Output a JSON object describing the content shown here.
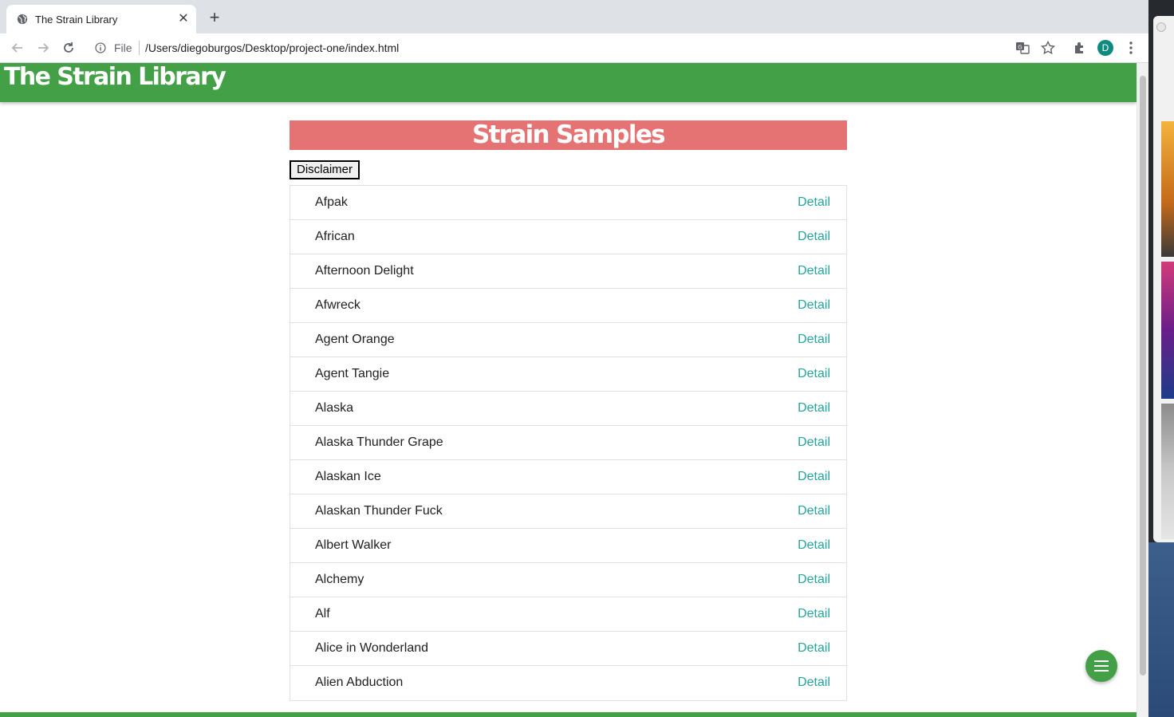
{
  "browser": {
    "tab_title": "The Strain Library",
    "omnibox_scheme": "File",
    "url": "/Users/diegoburgos/Desktop/project-one/index.html",
    "profile_initial": "D"
  },
  "site": {
    "title": "The Strain Library",
    "section_title": "Strain Samples",
    "disclaimer_label": "Disclaimer",
    "detail_label": "Detail",
    "colors": {
      "header": "#43a047",
      "banner": "#e57373",
      "link": "#26a69a"
    }
  },
  "strains": [
    {
      "name": "Afpak",
      "link": "Detail"
    },
    {
      "name": "African",
      "link": "Detail"
    },
    {
      "name": "Afternoon Delight",
      "link": "Detail"
    },
    {
      "name": "Afwreck",
      "link": "Detail"
    },
    {
      "name": "Agent Orange",
      "link": "Detail"
    },
    {
      "name": "Agent Tangie",
      "link": "Detail"
    },
    {
      "name": "Alaska",
      "link": "Detail"
    },
    {
      "name": "Alaska Thunder Grape",
      "link": "Detail"
    },
    {
      "name": "Alaskan Ice",
      "link": "Detail"
    },
    {
      "name": "Alaskan Thunder Fuck",
      "link": "Detail"
    },
    {
      "name": "Albert Walker",
      "link": "Detail"
    },
    {
      "name": "Alchemy",
      "link": "Detail"
    },
    {
      "name": "Alf",
      "link": "Detail"
    },
    {
      "name": "Alice in Wonderland",
      "link": "Detail"
    },
    {
      "name": "Alien Abduction",
      "link": "Detail"
    }
  ],
  "icons": {
    "fab": "menu-icon"
  }
}
